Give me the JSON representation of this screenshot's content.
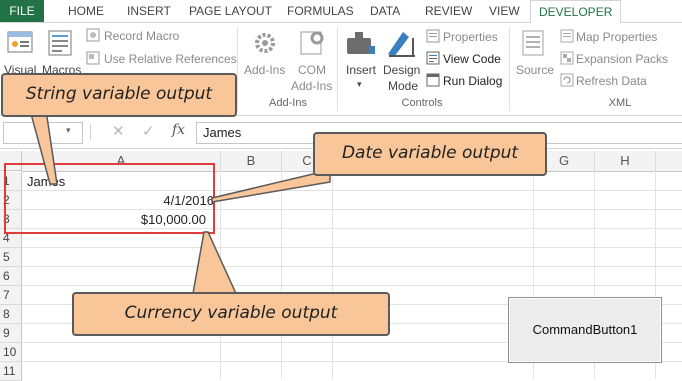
{
  "tabs": [
    "FILE",
    "HOME",
    "INSERT",
    "PAGE LAYOUT",
    "FORMULAS",
    "DATA",
    "REVIEW",
    "VIEW",
    "DEVELOPER"
  ],
  "ribbon": {
    "code": {
      "visual_basic": "Visual",
      "macros": "Macros",
      "record_macro": "Record Macro",
      "relative_refs": "Use Relative References"
    },
    "addins": {
      "addins": "Add-Ins",
      "com_line1": "COM",
      "com_line2": "Add-Ins",
      "group_label": "Add-Ins"
    },
    "controls": {
      "insert": "Insert",
      "design_line1": "Design",
      "design_line2": "Mode",
      "properties": "Properties",
      "view_code": "View Code",
      "run_dialog": "Run Dialog",
      "group_label": "Controls"
    },
    "xml": {
      "source": "Source",
      "map_properties": "Map Properties",
      "expansion_packs": "Expansion Packs",
      "refresh_data": "Refresh Data",
      "group_label": "XML"
    }
  },
  "formula_bar": {
    "name_box": "",
    "fx_symbol": "fx",
    "value": "James"
  },
  "columns": [
    "A",
    "B",
    "C",
    "G",
    "H"
  ],
  "rows": [
    "1",
    "2",
    "3",
    "4",
    "5",
    "6",
    "7",
    "8",
    "9",
    "10",
    "11"
  ],
  "cells": {
    "a1": "James",
    "a2": "4/1/2016",
    "a3": "$10,000.00"
  },
  "callouts": {
    "string": "String variable output",
    "date": "Date variable output",
    "currency": "Currency variable output"
  },
  "command_button": "CommandButton1",
  "colors": {
    "file_tab": "#217346",
    "callout_fill": "#f8c699",
    "highlight_box": "#e03c3c"
  }
}
